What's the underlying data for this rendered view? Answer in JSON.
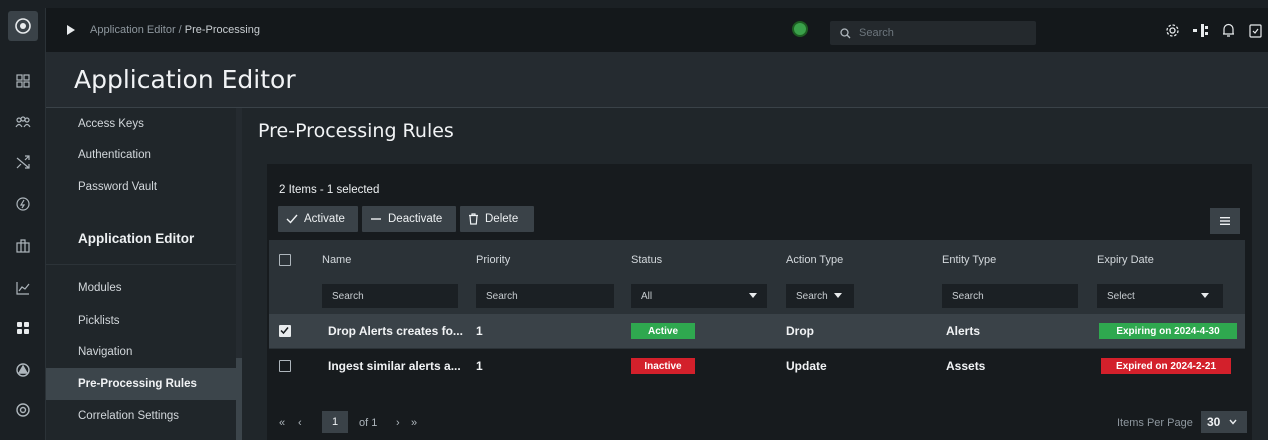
{
  "colors": {
    "active": "#2fa84f",
    "inactive": "#d3202b",
    "expiring": "#2fa84f",
    "expired": "#d3202b",
    "accent_status": "#3aa04a"
  },
  "rail": {
    "icons": [
      "logo-icon",
      "dashboard-icon",
      "team-icon",
      "shuffle-icon",
      "bolt-icon",
      "briefcase-icon",
      "chart-icon",
      "grid-icon",
      "shield-icon",
      "help-icon"
    ]
  },
  "topbar": {
    "breadcrumb_parent": "Application Editor /",
    "breadcrumb_current": "Pre-Processing",
    "search_placeholder": "Search",
    "icons": [
      "gear-icon",
      "flow-icon",
      "bell-icon",
      "clipboard-icon",
      "user-icon"
    ]
  },
  "page": {
    "title": "Application Editor"
  },
  "sidemenu": {
    "items_top": [
      "Access Keys",
      "Authentication",
      "Password Vault"
    ],
    "section": "Application Editor",
    "items": [
      "Modules",
      "Picklists",
      "Navigation",
      "Pre-Processing Rules",
      "Correlation Settings"
    ]
  },
  "content": {
    "title": "Pre-Processing Rules",
    "count": "2 Items - 1 selected",
    "actions": {
      "activate": "Activate",
      "deactivate": "Deactivate",
      "delete": "Delete"
    },
    "columns": [
      "Name",
      "Priority",
      "Status",
      "Action Type",
      "Entity Type",
      "Expiry Date"
    ],
    "filters": [
      "Search",
      "Search",
      "All",
      "Search",
      "Search",
      "Select"
    ],
    "rows": [
      {
        "name": "Drop Alerts creates fo...",
        "priority": "1",
        "status": "Active",
        "action": "Drop",
        "entity": "Alerts",
        "expiry": "Expiring on 2024-4-30",
        "selected": true
      },
      {
        "name": "Ingest similar alerts a...",
        "priority": "1",
        "status": "Inactive",
        "action": "Update",
        "entity": "Assets",
        "expiry": "Expired on 2024-2-21",
        "selected": false
      }
    ]
  },
  "pagination": {
    "first": "«",
    "prev": "‹",
    "page": "1",
    "of": "of 1",
    "next": "›",
    "last": "»",
    "items_per_page_label": "Items Per Page",
    "items_per_page": "30"
  }
}
